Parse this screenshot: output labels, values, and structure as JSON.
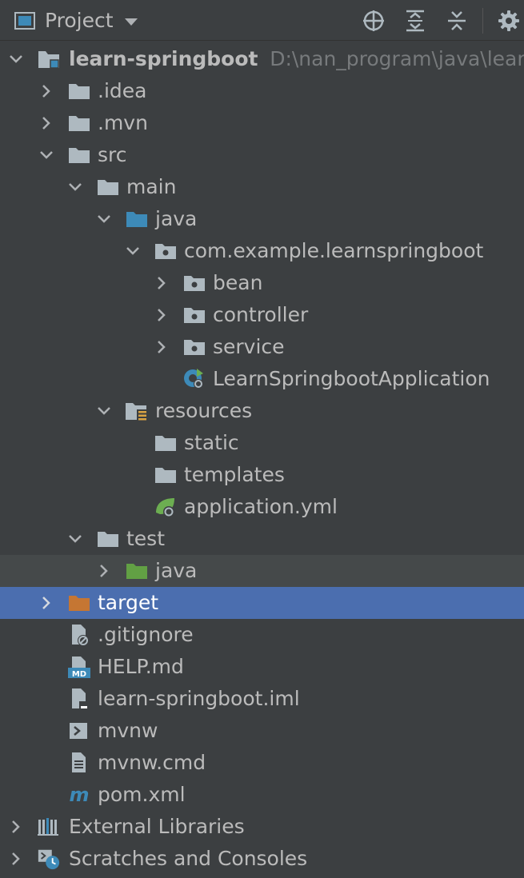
{
  "toolbar": {
    "project_label": "Project",
    "icons": [
      "locate-icon",
      "expand-all-icon",
      "collapse-all-icon",
      "settings-icon"
    ]
  },
  "tree": {
    "root": {
      "name": "learn-springboot",
      "path": "D:\\nan_program\\java\\learn"
    },
    "idea": ".idea",
    "mvn": ".mvn",
    "src": "src",
    "main": "main",
    "main_java": "java",
    "package": "com.example.learnspringboot",
    "bean": "bean",
    "controller": "controller",
    "service": "service",
    "app_class": "LearnSpringbootApplication",
    "resources": "resources",
    "static": "static",
    "templates": "templates",
    "application_yml": "application.yml",
    "test": "test",
    "test_java": "java",
    "target": "target",
    "gitignore": ".gitignore",
    "help_md": "HELP.md",
    "iml": "learn-springboot.iml",
    "mvnw": "mvnw",
    "mvnw_cmd": "mvnw.cmd",
    "pom": "pom.xml",
    "external_libraries": "External Libraries",
    "scratches": "Scratches and Consoles"
  },
  "colors": {
    "background": "#3c3f41",
    "selection": "#4b6eaf",
    "folder": "#aeb9c0",
    "source_folder": "#3d8ab8",
    "test_folder": "#62a044",
    "excluded_folder": "#c57633",
    "spring_green": "#6cae51"
  }
}
